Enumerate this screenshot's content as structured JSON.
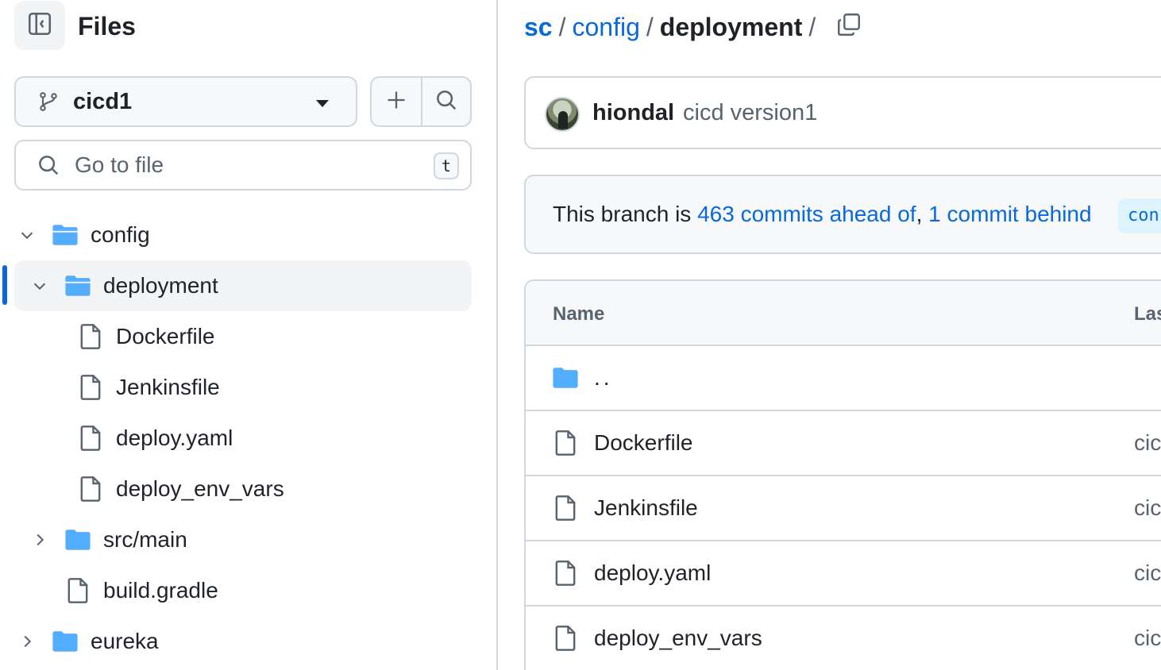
{
  "sidebar": {
    "title": "Files",
    "branch": "cicd1",
    "goto_placeholder": "Go to file",
    "goto_shortcut": "t",
    "tree": [
      {
        "label": "config",
        "type": "folder",
        "expanded": true,
        "depth": 0
      },
      {
        "label": "deployment",
        "type": "folder",
        "expanded": true,
        "depth": 1,
        "active": true
      },
      {
        "label": "Dockerfile",
        "type": "file",
        "depth": 2
      },
      {
        "label": "Jenkinsfile",
        "type": "file",
        "depth": 2
      },
      {
        "label": "deploy.yaml",
        "type": "file",
        "depth": 2
      },
      {
        "label": "deploy_env_vars",
        "type": "file",
        "depth": 2
      },
      {
        "label": "src/main",
        "type": "folder",
        "expanded": false,
        "depth": 1
      },
      {
        "label": "build.gradle",
        "type": "file",
        "depth": 1
      },
      {
        "label": "eureka",
        "type": "folder",
        "expanded": false,
        "depth": 0
      }
    ]
  },
  "breadcrumb": {
    "items": [
      "sc",
      "config",
      "deployment"
    ],
    "separator": "/"
  },
  "commit": {
    "author": "hiondal",
    "message": "cicd version1"
  },
  "branch_status": {
    "prefix": "This branch is ",
    "ahead": "463 commits ahead of",
    "comma": ",",
    "behind": "1 commit behind",
    "base_branch": "con"
  },
  "table": {
    "col_name": "Name",
    "col_last": "Las",
    "parent_dir": "..",
    "rows": [
      {
        "name": "Dockerfile",
        "message": "cic"
      },
      {
        "name": "Jenkinsfile",
        "message": "cic"
      },
      {
        "name": "deploy.yaml",
        "message": "cic"
      },
      {
        "name": "deploy_env_vars",
        "message": "cic"
      }
    ]
  },
  "colors": {
    "accent": "#0969da",
    "folder": "#54aeff",
    "border": "#d0d7de",
    "muted": "#59636e"
  }
}
